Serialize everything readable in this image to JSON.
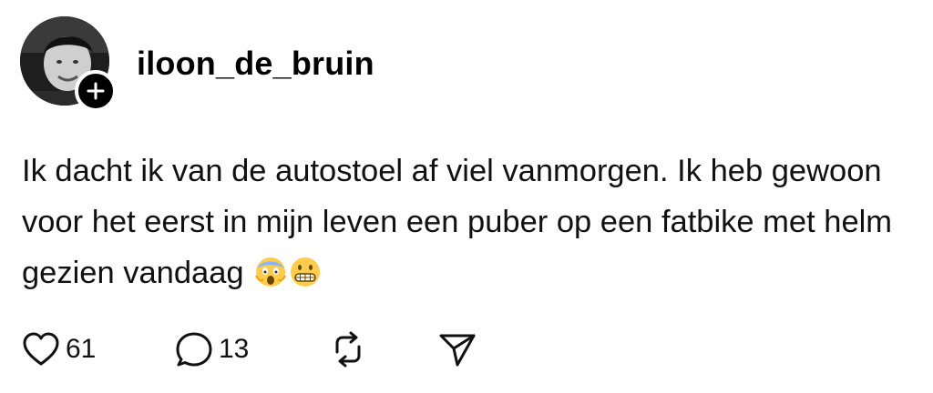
{
  "post": {
    "username": "iloon_de_bruin",
    "text": "Ik dacht ik van de autostoel af viel vanmorgen. Ik heb gewoon voor het eerst in mijn leven een puber op een fatbike met helm gezien vandaag",
    "emojis": [
      "😱",
      "😬"
    ],
    "likes": "61",
    "replies": "13"
  },
  "icons": {
    "avatar": "profile-photo",
    "follow": "plus-icon",
    "like": "heart-icon",
    "reply": "speech-bubble-icon",
    "repost": "repost-icon",
    "share": "send-icon"
  }
}
